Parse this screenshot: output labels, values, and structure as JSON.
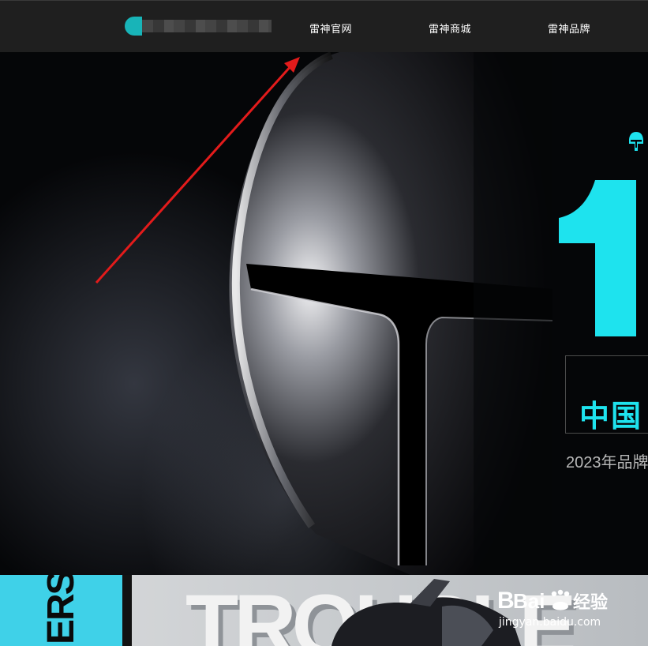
{
  "nav": {
    "links": [
      {
        "label": "雷神官网"
      },
      {
        "label": "雷神商城"
      },
      {
        "label": "雷神品牌"
      }
    ]
  },
  "hero": {
    "big_number": "1",
    "headline": "中国",
    "subline": "2023年品牌"
  },
  "banner": {
    "vertical_text": "ERS",
    "big_text": "TROUBLE"
  },
  "watermark": {
    "brand_a": "Bai",
    "brand_b": "经验",
    "url": "jingyan.baidu.com"
  },
  "colors": {
    "accent": "#1ee3ee",
    "nav_bg": "#1f1f1f",
    "annotation": "#e31b1b",
    "banner_strip": "#3fd1e8"
  },
  "icons": [
    "helmet-brand-icon",
    "red-annotation-arrow",
    "baidu-paw-icon"
  ]
}
